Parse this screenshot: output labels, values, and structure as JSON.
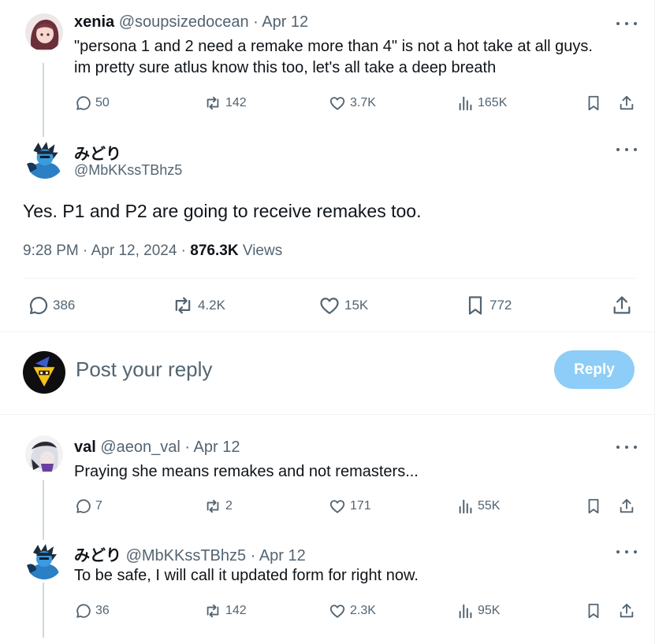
{
  "tweets": [
    {
      "name": "xenia",
      "handle": "@soupsizedocean",
      "date": "· Apr 12",
      "text_lines": [
        "\"persona 1 and 2 need a remake more than 4\" is not a hot take at all guys.",
        "im pretty sure atlus know this too, let's all take a deep breath"
      ],
      "stats": {
        "replies": "50",
        "reposts": "142",
        "likes": "3.7K",
        "views": "165K"
      }
    },
    {
      "name": "val",
      "handle": "@aeon_val",
      "date": "· Apr 12",
      "text": "Praying she means remakes and not remasters...",
      "stats": {
        "replies": "7",
        "reposts": "2",
        "likes": "171",
        "views": "55K"
      }
    },
    {
      "name": "みどり",
      "handle": "@MbKKssTBhz5",
      "date": "· Apr 12",
      "text": "To be safe, I will call it updated form for right now.",
      "stats": {
        "replies": "36",
        "reposts": "142",
        "likes": "2.3K",
        "views": "95K"
      }
    }
  ],
  "main_tweet": {
    "name": "みどり",
    "handle": "@MbKKssTBhz5",
    "text": "Yes. P1 and P2 are going to receive remakes too.",
    "timestamp": "9:28 PM · Apr 12, 2024 ·",
    "views_count": "876.3K",
    "views_label": "Views",
    "stats": {
      "replies": "386",
      "reposts": "4.2K",
      "likes": "15K",
      "bookmarks": "772"
    }
  },
  "composer": {
    "placeholder": "Post your reply",
    "reply_label": "Reply"
  },
  "colors": {
    "text_primary": "#0f1419",
    "text_secondary": "#536471",
    "reply_button_disabled": "#8ecdf7",
    "divider": "#eff3f4"
  }
}
